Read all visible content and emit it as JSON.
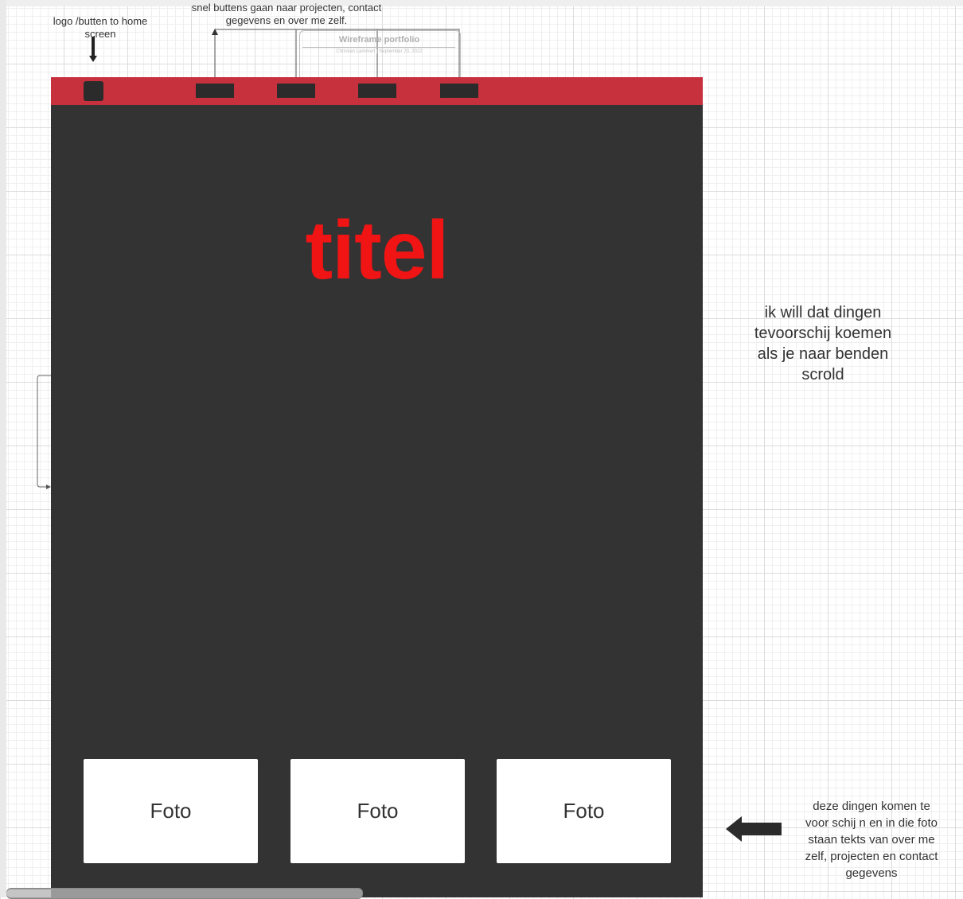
{
  "annotations": {
    "logo_note": "logo /butten to home screen",
    "nav_note": "snel buttens gaan naar projecten, contact gegevens en over me zelf.",
    "scroll_note": "ik will dat dingen tevoorschij koemen als je naar benden scrold",
    "cards_note": "deze dingen komen te voor schij n en in die foto staan tekts van over me zelf, projecten en contact gegevens"
  },
  "mini_preview": {
    "title": "Wireframe portfolio",
    "meta": "Christian Lammert | September 23, 2022"
  },
  "hero": {
    "title": "titel"
  },
  "cards": [
    {
      "label": "Foto"
    },
    {
      "label": "Foto"
    },
    {
      "label": "Foto"
    }
  ],
  "colors": {
    "navbar": "#c7303d",
    "frame": "#333333",
    "title": "#f01414",
    "card": "#ffffff"
  },
  "icons": [
    "arrow-down-icon",
    "arrow-left-icon",
    "connector-arrow-icon"
  ]
}
